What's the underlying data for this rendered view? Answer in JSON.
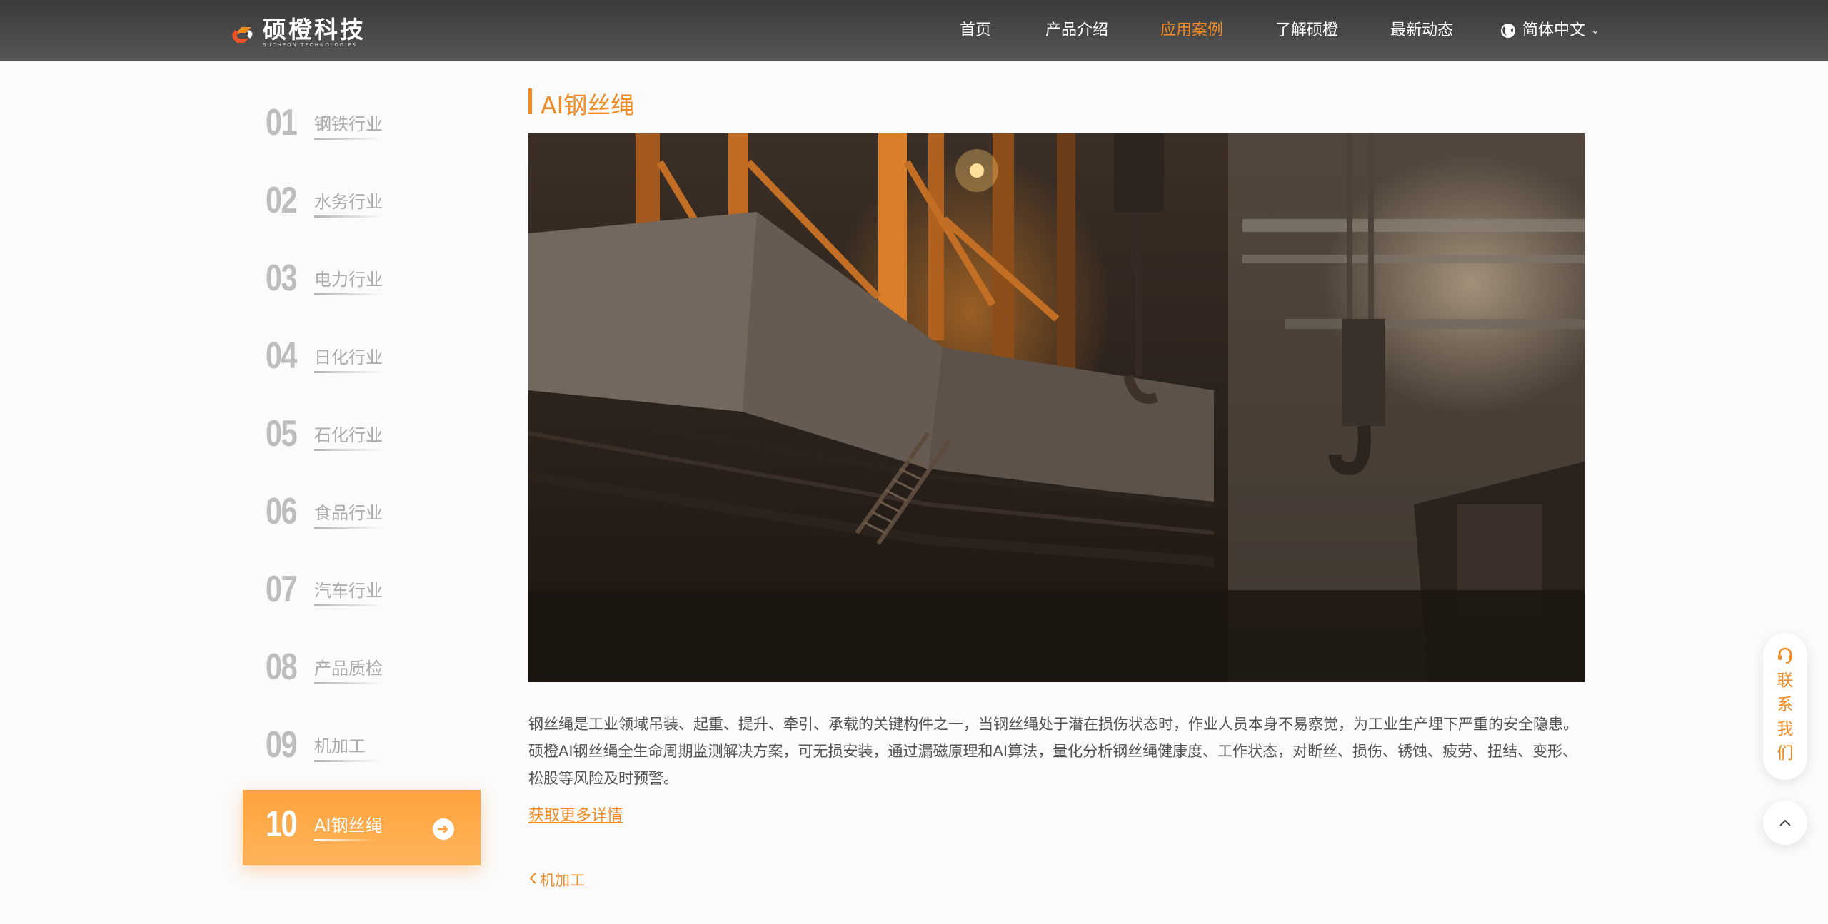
{
  "header": {
    "logo": {
      "cn": "硕橙科技",
      "en": "SUCHEON TECHNOLOGIES"
    },
    "nav": [
      {
        "label": "首页",
        "active": false
      },
      {
        "label": "产品介绍",
        "active": false
      },
      {
        "label": "应用案例",
        "active": true
      },
      {
        "label": "了解硕橙",
        "active": false
      },
      {
        "label": "最新动态",
        "active": false
      }
    ],
    "language": {
      "label": "简体中文",
      "icon": "globe-icon"
    }
  },
  "sidebar": {
    "items": [
      {
        "num": "01",
        "label": "钢铁行业",
        "active": false
      },
      {
        "num": "02",
        "label": "水务行业",
        "active": false
      },
      {
        "num": "03",
        "label": "电力行业",
        "active": false
      },
      {
        "num": "04",
        "label": "日化行业",
        "active": false
      },
      {
        "num": "05",
        "label": "石化行业",
        "active": false
      },
      {
        "num": "06",
        "label": "食品行业",
        "active": false
      },
      {
        "num": "07",
        "label": "汽车行业",
        "active": false
      },
      {
        "num": "08",
        "label": "产品质检",
        "active": false
      },
      {
        "num": "09",
        "label": "机加工",
        "active": false
      },
      {
        "num": "10",
        "label": "AI钢丝绳",
        "active": true
      }
    ]
  },
  "main": {
    "title": "AI钢丝绳",
    "description": "钢丝绳是工业领域吊装、起重、提升、牵引、承载的关键构件之一，当钢丝绳处于潜在损伤状态时，作业人员本身不易察觉，为工业生产埋下严重的安全隐患。硕橙AI钢丝绳全生命周期监测解决方案，可无损安装，通过漏磁原理和AI算法，量化分析钢丝绳健康度、工作状态，对断丝、损伤、锈蚀、疲劳、扭结、变形、松股等风险及时预警。",
    "more_link": "获取更多详情",
    "prev_link": "机加工"
  },
  "floating": {
    "contact_label": "联系我们",
    "contact_icon": "headset-icon",
    "to_top_icon": "chevron-up-icon"
  },
  "colors": {
    "accent": "#f08a24",
    "active_item": "#ffa23e",
    "header_bg": "#444444"
  }
}
